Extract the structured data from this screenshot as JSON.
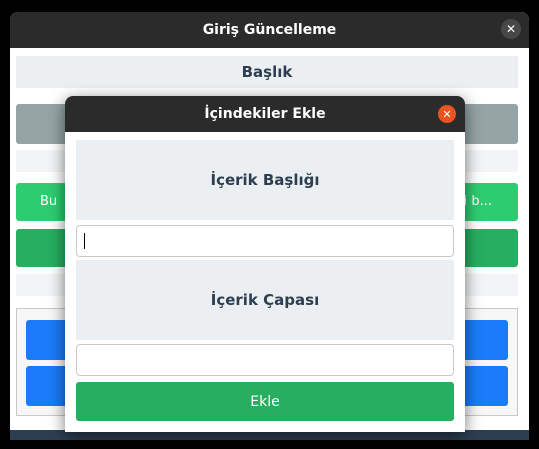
{
  "main_window": {
    "title": "Giriş Güncelleme",
    "close_glyph": "✕",
    "heading": "Başlık",
    "green_button_text_left": "Bu",
    "green_button_text_right": "i b..."
  },
  "dialog": {
    "title": "İçindekiler Ekle",
    "close_glyph": "✕",
    "content_title_label": "İçerik Başlığı",
    "content_title_value": "",
    "content_anchor_label": "İçerik Çapası",
    "content_anchor_value": "",
    "add_button_label": "Ekle"
  },
  "colors": {
    "titlebar": "#2b2b2b",
    "close_accent": "#e95420",
    "green": "#2ecc71",
    "green_dark": "#27ae60",
    "blue": "#1a7cf9",
    "gray_bar": "#95a5a6",
    "label_bg": "#eceff1",
    "label_text": "#2c3e50"
  }
}
